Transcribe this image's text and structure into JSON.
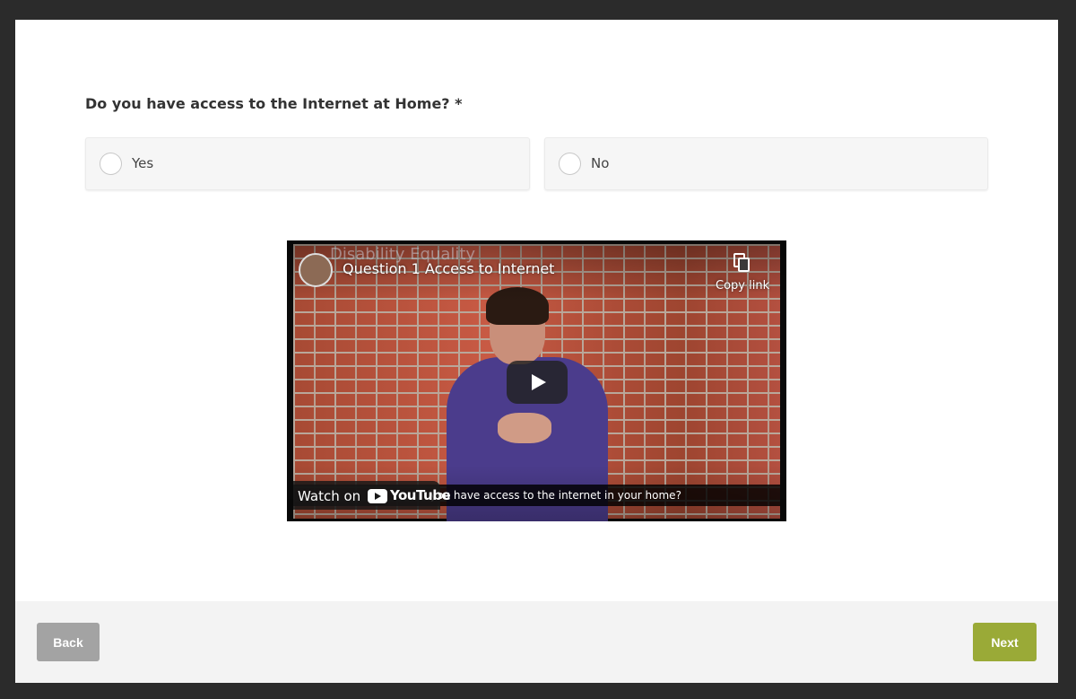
{
  "question": {
    "text": "Do you have access to the Internet at Home? *"
  },
  "options": [
    {
      "label": "Yes",
      "selected": false
    },
    {
      "label": "No",
      "selected": false
    }
  ],
  "video": {
    "logo_text": "Disability Equality",
    "title": "Question 1 Access to Internet",
    "copy_link_label": "Copy link",
    "caption": "you have access to the internet in your home?",
    "watch_on_label": "Watch on",
    "platform_label": "YouTube"
  },
  "footer": {
    "back_label": "Back",
    "next_label": "Next"
  },
  "colors": {
    "next_button": "#9aaa37",
    "back_button": "#a3a3a3",
    "page_background": "#2b2b2b"
  }
}
